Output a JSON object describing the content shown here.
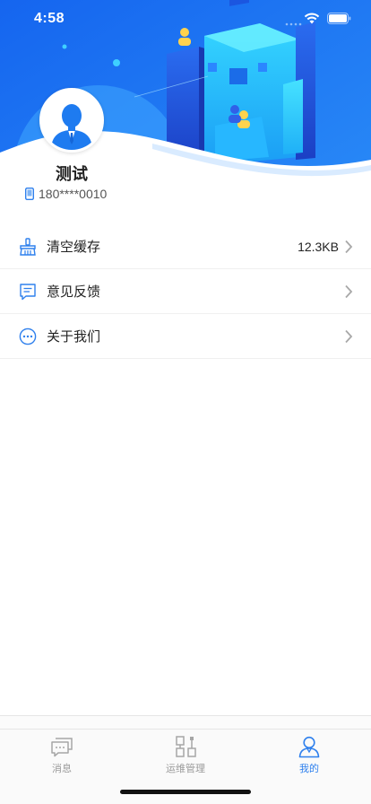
{
  "status_bar": {
    "time": "4:58"
  },
  "profile": {
    "name": "测试",
    "phone": "180****0010"
  },
  "menu": [
    {
      "label": "清空缓存",
      "value": "12.3KB",
      "icon": "broom-icon"
    },
    {
      "label": "意见反馈",
      "value": "",
      "icon": "feedback-icon"
    },
    {
      "label": "关于我们",
      "value": "",
      "icon": "more-dots-icon"
    }
  ],
  "tabs": [
    {
      "label": "消息",
      "icon": "chat-icon",
      "active": false
    },
    {
      "label": "运维管理",
      "icon": "flowchart-icon",
      "active": false
    },
    {
      "label": "我的",
      "icon": "user-icon",
      "active": true
    }
  ],
  "colors": {
    "accent": "#2f80ed",
    "header_blue": "#1e7bf0",
    "header_light": "#3fc6ff"
  }
}
